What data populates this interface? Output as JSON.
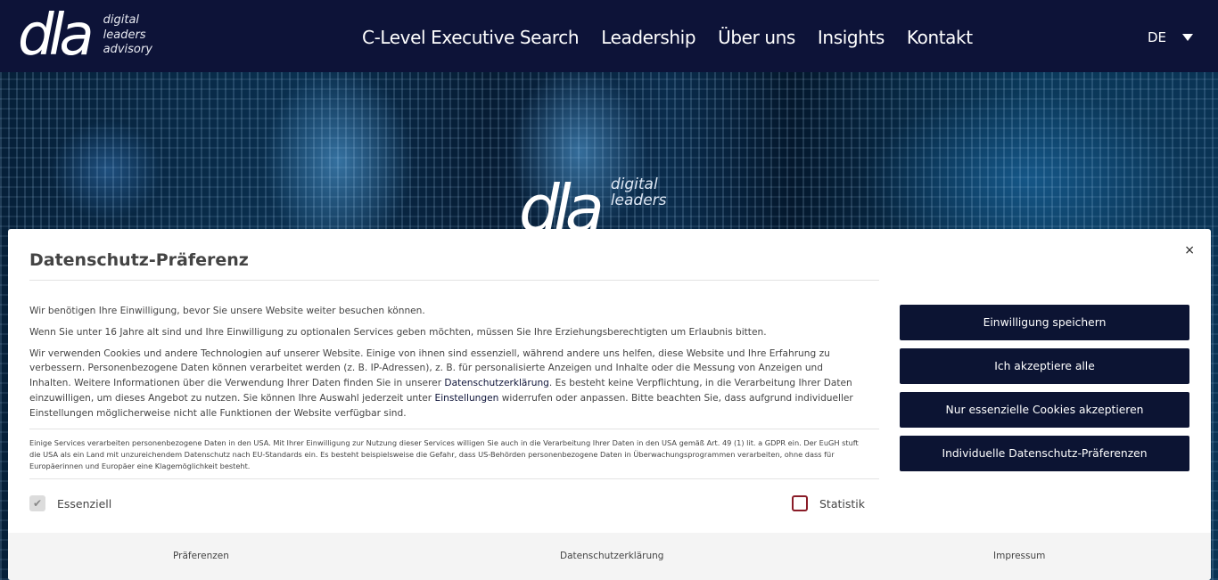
{
  "header": {
    "logo_mark": "dla",
    "logo_lines": [
      "digital",
      "leaders",
      "advisory"
    ],
    "nav": [
      "C-Level Executive Search",
      "Leadership",
      "Über uns",
      "Insights",
      "Kontakt"
    ],
    "language": "DE"
  },
  "hero": {
    "logo_mark": "dla",
    "logo_lines": [
      "digital",
      "leaders"
    ]
  },
  "modal": {
    "title": "Datenschutz-Präferenz",
    "close": "×",
    "p1": "Wir benötigen Ihre Einwilligung, bevor Sie unsere Website weiter besuchen können.",
    "p2": "Wenn Sie unter 16 Jahre alt sind und Ihre Einwilligung zu optionalen Services geben möchten, müssen Sie Ihre Erziehungsberechtigten um Erlaubnis bitten.",
    "p3a": "Wir verwenden Cookies und andere Technologien auf unserer Website. Einige von ihnen sind essenziell, während andere uns helfen, diese Website und Ihre Erfahrung zu verbessern. Personenbezogene Daten können verarbeitet werden (z. B. IP-Adressen), z. B. für personalisierte Anzeigen und Inhalte oder die Messung von Anzeigen und Inhalten. Weitere Informationen über die Verwendung Ihrer Daten finden Sie in unserer ",
    "p3_link1": "Datenschutzerklärung",
    "p3b": ". Es besteht keine Verpflichtung, in die Verarbeitung Ihrer Daten einzuwilligen, um dieses Angebot zu nutzen. Sie können Ihre Auswahl jederzeit unter ",
    "p3_link2": "Einstellungen",
    "p3c": " widerrufen oder anpassen. Bitte beachten Sie, dass aufgrund individueller Einstellungen möglicherweise nicht alle Funktionen der Website verfügbar sind.",
    "small": "Einige Services verarbeiten personenbezogene Daten in den USA. Mit Ihrer Einwilligung zur Nutzung dieser Services willigen Sie auch in die Verarbeitung Ihrer Daten in den USA gemäß Art. 49 (1) lit. a GDPR ein. Der EuGH stuft die USA als ein Land mit unzureichendem Datenschutz nach EU-Standards ein. Es besteht beispielsweise die Gefahr, dass US-Behörden personenbezogene Daten in Überwachungsprogrammen verarbeiten, ohne dass für Europäerinnen und Europäer eine Klagemöglichkeit besteht.",
    "checkbox_essential": "Essenziell",
    "checkbox_statistics": "Statistik",
    "buttons": [
      "Einwilligung speichern",
      "Ich akzeptiere alle",
      "Nur essenzielle Cookies akzeptieren",
      "Individuelle Datenschutz-Präferenzen"
    ],
    "footer": [
      "Präferenzen",
      "Datenschutzerklärung",
      "Impressum"
    ]
  },
  "colors": {
    "header_bg": "#0d1338",
    "button_bg": "#0c1433",
    "checkbox_border": "#8a1c28"
  }
}
